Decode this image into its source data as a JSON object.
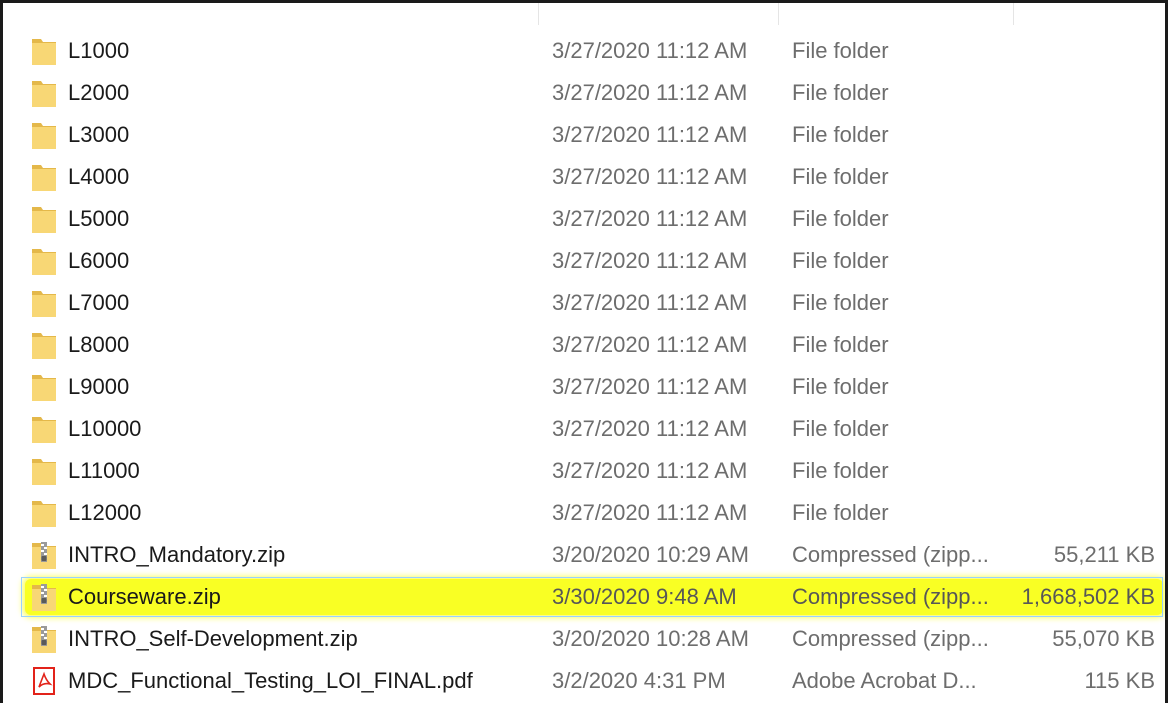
{
  "colors": {
    "folder": "#f8d775",
    "folder_dark": "#e4b84a",
    "highlight": "#f9ff24",
    "selection_border": "#99d1ff",
    "pdf_red": "#e2231a",
    "secondary_text": "#6d6d6d"
  },
  "files": [
    {
      "name": "L1000",
      "date": "3/27/2020 11:12 AM",
      "type": "File folder",
      "size": "",
      "icon": "folder-icon"
    },
    {
      "name": "L2000",
      "date": "3/27/2020 11:12 AM",
      "type": "File folder",
      "size": "",
      "icon": "folder-icon"
    },
    {
      "name": "L3000",
      "date": "3/27/2020 11:12 AM",
      "type": "File folder",
      "size": "",
      "icon": "folder-icon"
    },
    {
      "name": "L4000",
      "date": "3/27/2020 11:12 AM",
      "type": "File folder",
      "size": "",
      "icon": "folder-icon"
    },
    {
      "name": "L5000",
      "date": "3/27/2020 11:12 AM",
      "type": "File folder",
      "size": "",
      "icon": "folder-icon"
    },
    {
      "name": "L6000",
      "date": "3/27/2020 11:12 AM",
      "type": "File folder",
      "size": "",
      "icon": "folder-icon"
    },
    {
      "name": "L7000",
      "date": "3/27/2020 11:12 AM",
      "type": "File folder",
      "size": "",
      "icon": "folder-icon"
    },
    {
      "name": "L8000",
      "date": "3/27/2020 11:12 AM",
      "type": "File folder",
      "size": "",
      "icon": "folder-icon"
    },
    {
      "name": "L9000",
      "date": "3/27/2020 11:12 AM",
      "type": "File folder",
      "size": "",
      "icon": "folder-icon"
    },
    {
      "name": "L10000",
      "date": "3/27/2020 11:12 AM",
      "type": "File folder",
      "size": "",
      "icon": "folder-icon"
    },
    {
      "name": "L11000",
      "date": "3/27/2020 11:12 AM",
      "type": "File folder",
      "size": "",
      "icon": "folder-icon"
    },
    {
      "name": "L12000",
      "date": "3/27/2020 11:12 AM",
      "type": "File folder",
      "size": "",
      "icon": "folder-icon"
    },
    {
      "name": "INTRO_Mandatory.zip",
      "date": "3/20/2020 10:29 AM",
      "type": "Compressed (zipp...",
      "size": "55,211 KB",
      "icon": "zip-folder-icon"
    },
    {
      "name": "Courseware.zip",
      "date": "3/30/2020 9:48 AM",
      "type": "Compressed (zipp...",
      "size": "1,668,502 KB",
      "icon": "zip-folder-icon",
      "selected": true
    },
    {
      "name": "INTRO_Self-Development.zip",
      "date": "3/20/2020 10:28 AM",
      "type": "Compressed (zipp...",
      "size": "55,070 KB",
      "icon": "zip-folder-icon"
    },
    {
      "name": "MDC_Functional_Testing_LOI_FINAL.pdf",
      "date": "3/2/2020 4:31 PM",
      "type": "Adobe Acrobat D...",
      "size": "115 KB",
      "icon": "pdf-icon"
    }
  ]
}
